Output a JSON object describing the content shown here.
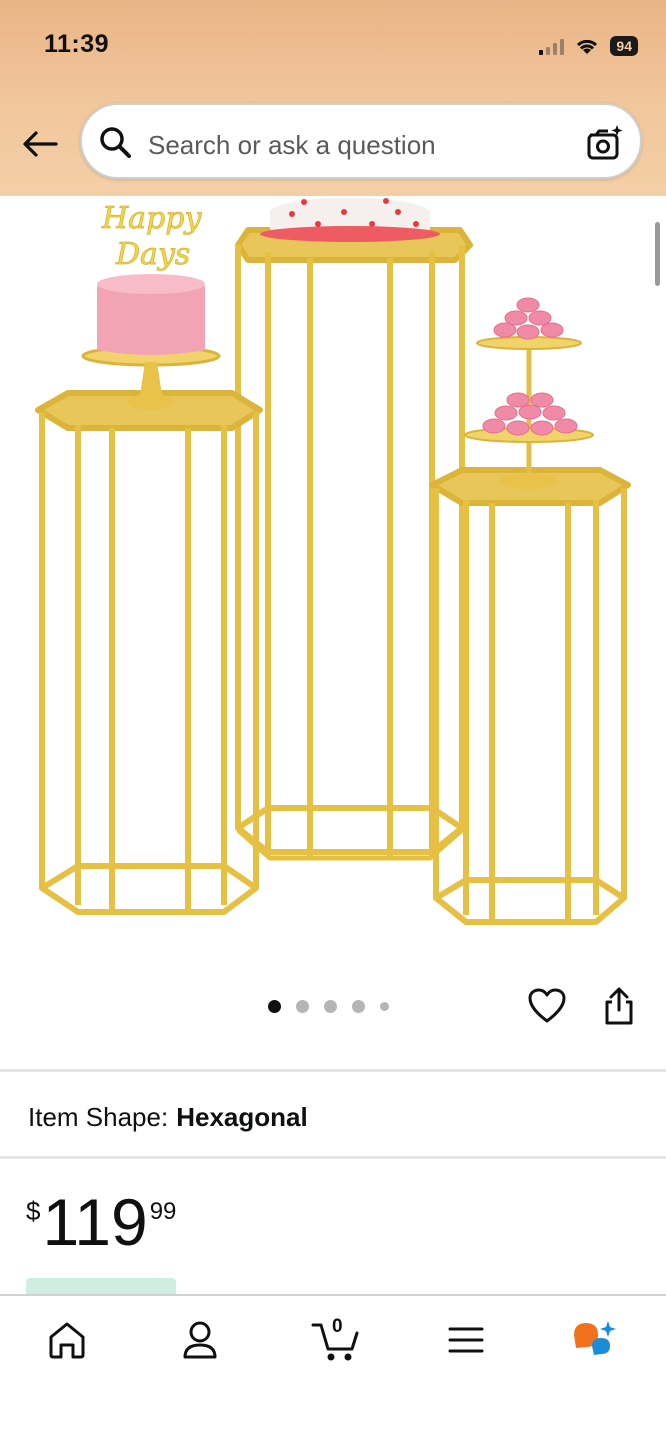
{
  "status": {
    "time": "11:39",
    "battery": "94"
  },
  "search": {
    "placeholder": "Search or ask a question"
  },
  "gallery": {
    "topper_text_1": "Happy",
    "topper_text_2": "Days",
    "image_count": 5,
    "active_index": 0
  },
  "product": {
    "shape_label": "Item Shape:",
    "shape_value": "Hexagonal",
    "price_symbol": "$",
    "price_whole": "119",
    "price_fraction": "99"
  },
  "tabbar": {
    "cart_count": "0"
  },
  "colors": {
    "header": "#f1c79c",
    "gold": "#e6c042",
    "text": "#0f1111",
    "accent_orange": "#f2711c",
    "accent_blue": "#1a8cd8"
  }
}
